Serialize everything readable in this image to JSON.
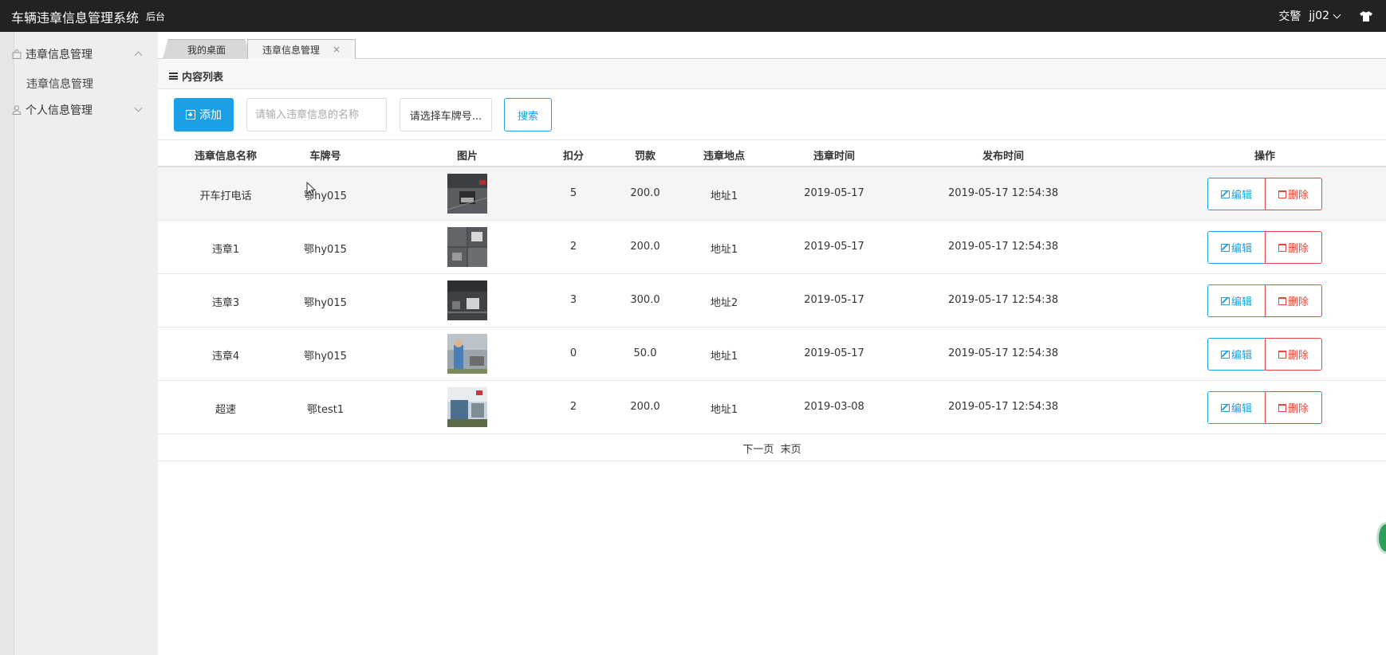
{
  "app": {
    "title": "车辆违章信息管理系统",
    "subtitle": "后台",
    "role": "交警",
    "username": "jj02"
  },
  "sidebar": {
    "menus": [
      {
        "label": "违章信息管理",
        "icon": "shopping-bag-icon",
        "expanded": true,
        "children": [
          {
            "label": "违章信息管理"
          }
        ]
      },
      {
        "label": "个人信息管理",
        "icon": "user-icon",
        "expanded": false,
        "children": []
      }
    ]
  },
  "tabs": [
    {
      "label": "我的桌面"
    },
    {
      "label": "违章信息管理",
      "close": "×"
    }
  ],
  "content": {
    "header": "内容列表"
  },
  "toolbar": {
    "add_label": "添加",
    "search_placeholder": "请输入违章信息的名称",
    "plate_select_label": "请选择车牌号...",
    "search_label": "搜索"
  },
  "table": {
    "columns": [
      "违章信息名称",
      "车牌号",
      "图片",
      "扣分",
      "罚款",
      "违章地点",
      "违章时间",
      "发布时间",
      "操作"
    ],
    "rows": [
      {
        "name": "开车打电话",
        "plate": "鄂hy015",
        "thumb": "thumb-1",
        "points": "5",
        "fine": "200.0",
        "place": "地址1",
        "time": "2019-05-17",
        "published": "2019-05-17 12:54:38"
      },
      {
        "name": "违章1",
        "plate": "鄂hy015",
        "thumb": "thumb-2",
        "points": "2",
        "fine": "200.0",
        "place": "地址1",
        "time": "2019-05-17",
        "published": "2019-05-17 12:54:38"
      },
      {
        "name": "违章3",
        "plate": "鄂hy015",
        "thumb": "thumb-3",
        "points": "3",
        "fine": "300.0",
        "place": "地址2",
        "time": "2019-05-17",
        "published": "2019-05-17 12:54:38"
      },
      {
        "name": "违章4",
        "plate": "鄂hy015",
        "thumb": "thumb-4",
        "points": "0",
        "fine": "50.0",
        "place": "地址1",
        "time": "2019-05-17",
        "published": "2019-05-17 12:54:38"
      },
      {
        "name": "超速",
        "plate": "鄂test1",
        "thumb": "thumb-5",
        "points": "2",
        "fine": "200.0",
        "place": "地址1",
        "time": "2019-03-08",
        "published": "2019-05-17 12:54:38"
      }
    ],
    "edit_label": "编辑",
    "delete_label": "删除"
  },
  "pager": {
    "next": "下一页",
    "last": "末页"
  },
  "colors": {
    "topbar": "#222222",
    "accent": "#1ba0e8",
    "danger": "#e8483b",
    "sidebar": "#eeeeee"
  }
}
